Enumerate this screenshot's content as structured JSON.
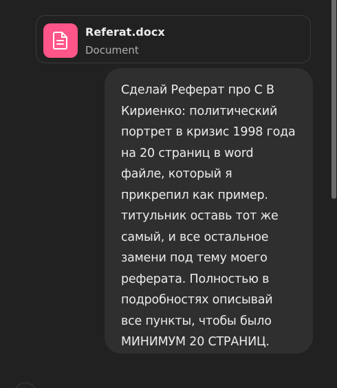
{
  "attachment": {
    "file_name": "Referat.docx",
    "file_type": "Document",
    "icon": "document-icon",
    "icon_color": "#ff5588"
  },
  "message": {
    "lines": [
      "Сделай Реферат про С В",
      "Кириенко: политический",
      "портрет в кризис 1998 года",
      "на 20 страниц в word",
      "файле, который я",
      "прикрепил как пример.",
      "титульник оставь тот же",
      "самый, и все остальное",
      "замени под тему моего",
      "реферата. Полностью в",
      "подробностях описывай",
      "все пункты, чтобы было",
      "МИНИМУМ 20 СТРАНИЦ."
    ]
  },
  "colors": {
    "background": "#212121",
    "bubble": "#2f2f2f",
    "text": "#ececec",
    "secondary_text": "#b0b0b0"
  }
}
